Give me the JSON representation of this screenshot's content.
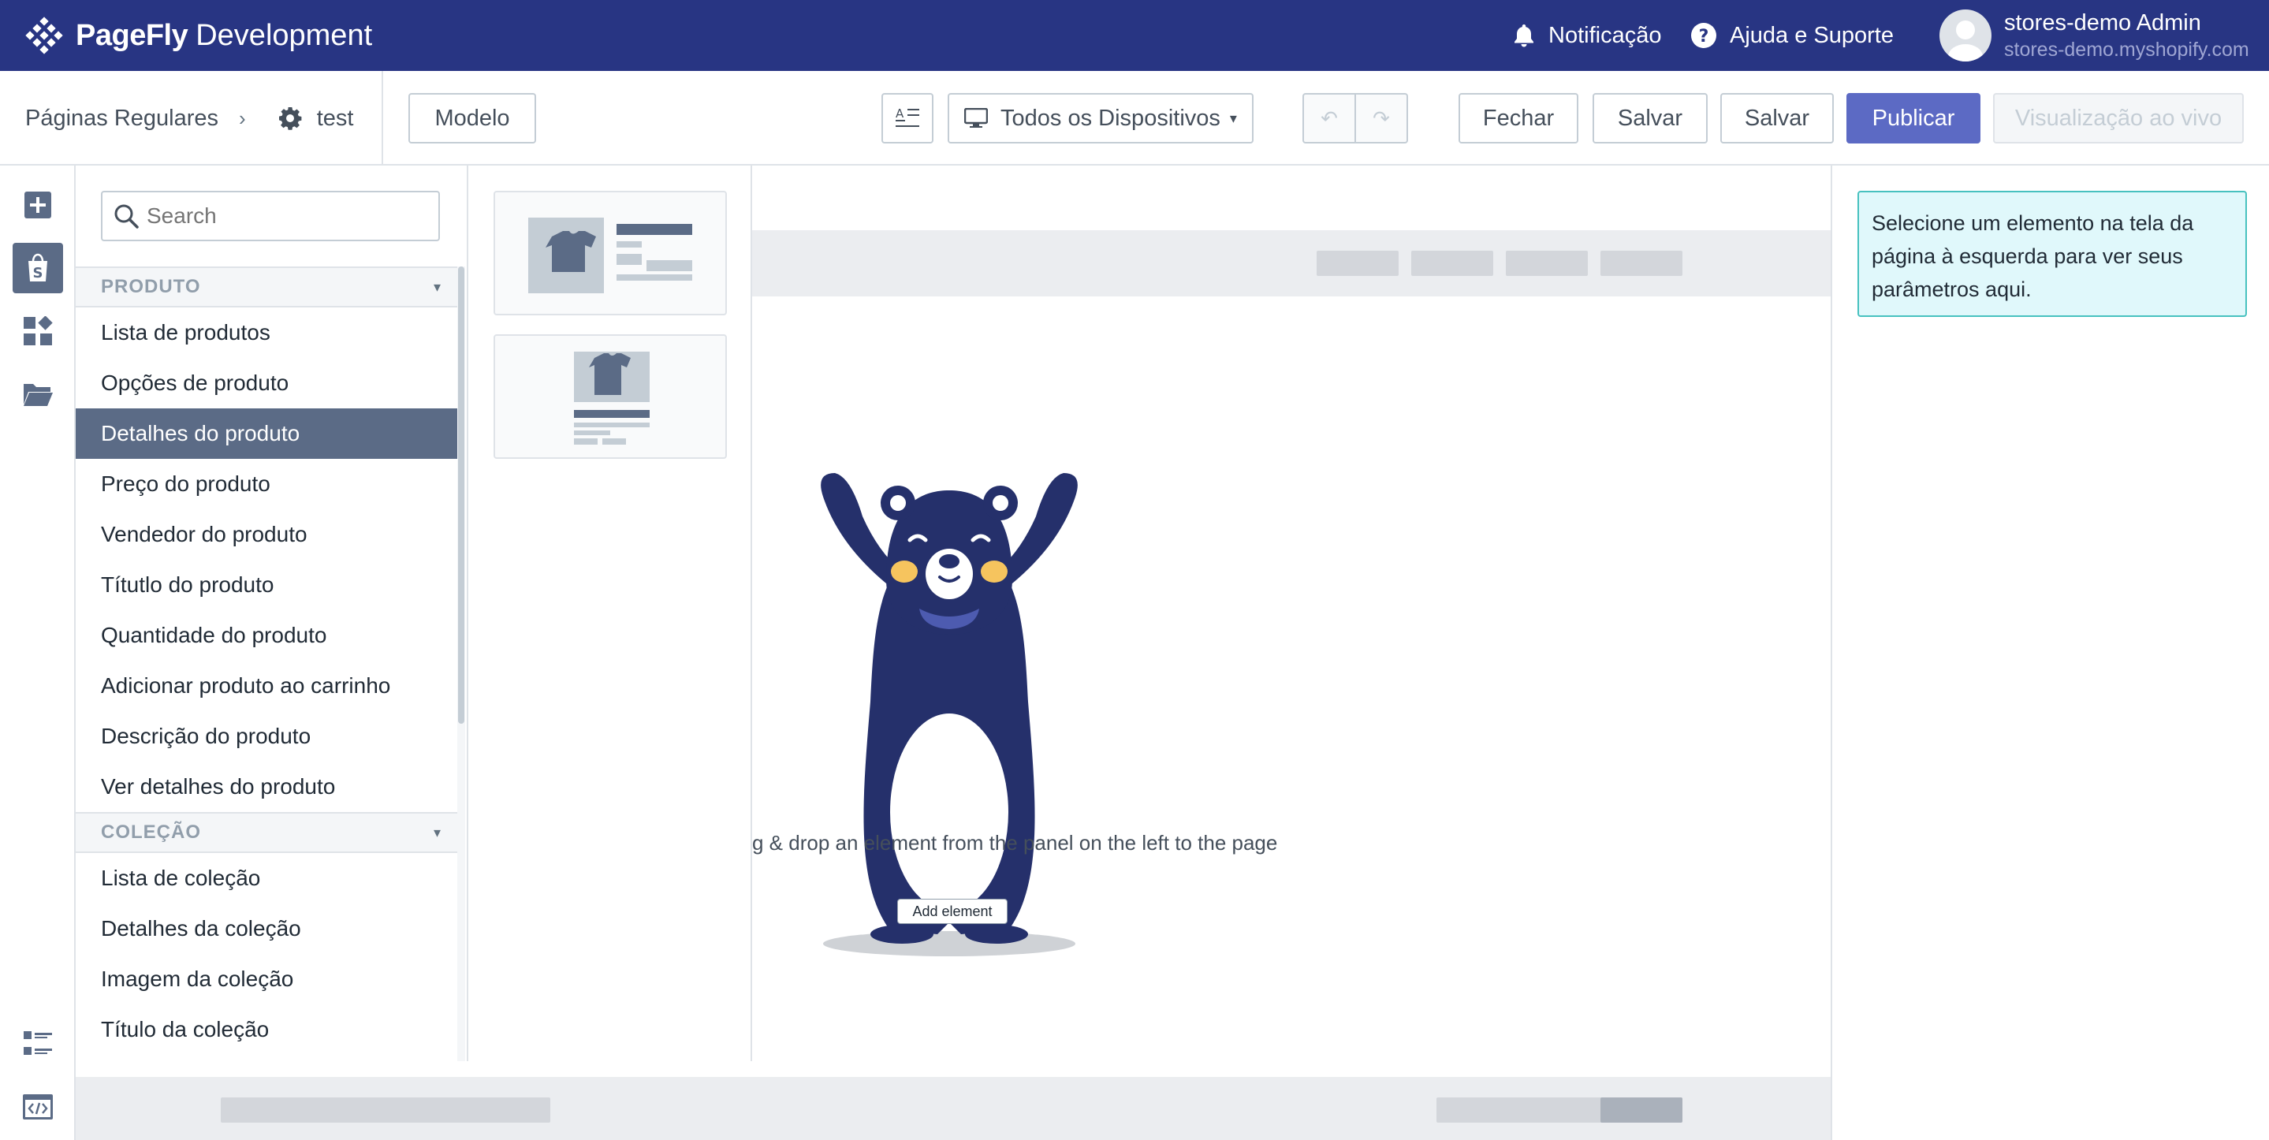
{
  "app": {
    "brand_bold": "PageFly",
    "brand_rest": "Development",
    "notification_label": "Notificação",
    "help_label": "Ajuda e Suporte",
    "user_name": "stores-demo Admin",
    "user_store": "stores-demo.myshopify.com"
  },
  "toolbar": {
    "breadcrumb_parent": "Páginas Regulares",
    "breadcrumb_separator": "›",
    "breadcrumb_current": "test",
    "template_label": "Modelo",
    "device_label": "Todos os Dispositivos",
    "close_label": "Fechar",
    "save_label": "Salvar",
    "save2_label": "Salvar",
    "publish_label": "Publicar",
    "live_preview_label": "Visualização ao vivo",
    "undo_glyph": "↶",
    "redo_glyph": "↷"
  },
  "panel": {
    "search_placeholder": "Search",
    "categories": [
      {
        "title": "PRODUTO",
        "items": [
          "Lista de produtos",
          "Opções de produto",
          "Detalhes do produto",
          "Preço do produto",
          "Vendedor do produto",
          "Títutlo do produto",
          "Quantidade do produto",
          "Adicionar produto ao carrinho",
          "Descrição do produto",
          "Ver detalhes do produto"
        ]
      },
      {
        "title": "COLEÇÃO",
        "items": [
          "Lista de coleção",
          "Detalhes da coleção",
          "Imagem da coleção",
          "Título da coleção"
        ]
      }
    ],
    "selected_item": "Detalhes do produto"
  },
  "canvas": {
    "hint": "g & drop an element from the panel on the left to the page",
    "add_element_label": "Add element"
  },
  "settings": {
    "info": "Selecione um elemento na tela da página à esquerda para ver seus parâmetros aqui."
  },
  "colors": {
    "topbar": "#283583",
    "primary": "#5c6ac4",
    "selected": "#5b6b86",
    "bear": "#25306b",
    "info_bg": "#e0f8fb",
    "info_border": "#47c1bf"
  },
  "icons": {
    "brand": "pagefly-logo-icon",
    "notification": "bell-icon",
    "help": "question-circle-icon",
    "rail": [
      "add-element-icon",
      "shopify-icon",
      "widgets-icon",
      "folder-icon",
      "list-icon",
      "code-icon"
    ]
  }
}
